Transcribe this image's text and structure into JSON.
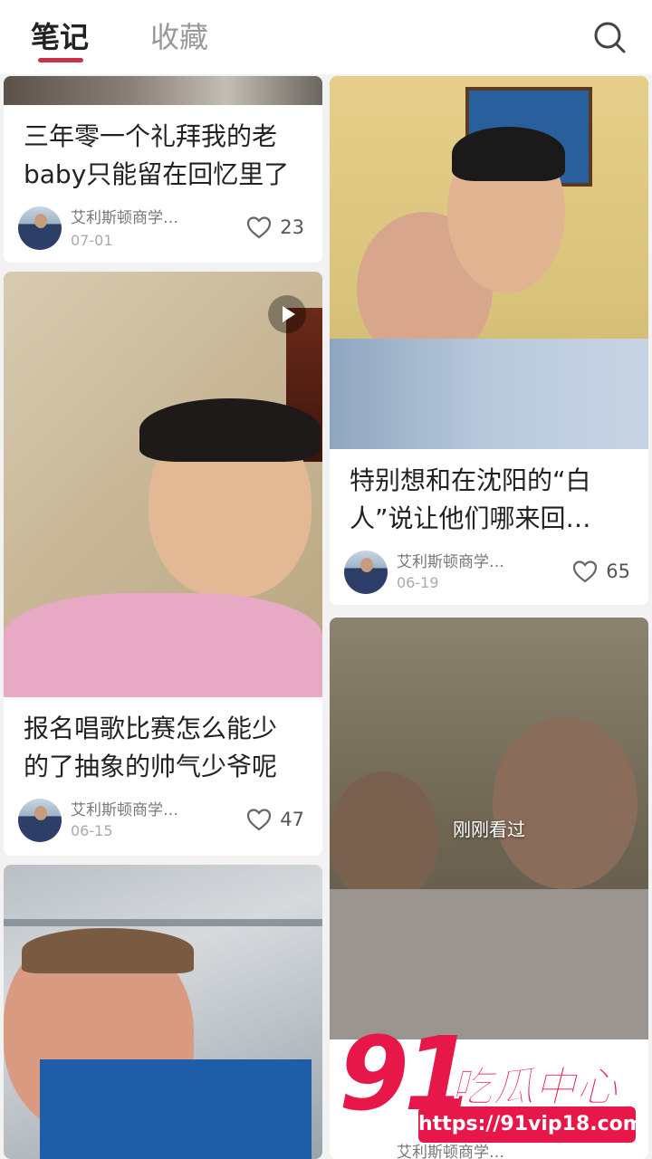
{
  "tabs": {
    "notes": "笔记",
    "favorites": "收藏"
  },
  "icons": {
    "search": "search-icon",
    "like": "heart-outline-icon",
    "play": "play-icon"
  },
  "colors": {
    "accent": "#c8324a",
    "watermark": "#e8174a"
  },
  "cards": {
    "c1": {
      "title_line1": "三年零一个礼拜我的老",
      "title_line2": "baby只能留在回忆里了",
      "author": "艾利斯顿商学…",
      "date": "07-01",
      "likes": "23"
    },
    "c2": {
      "title_line1": "报名唱歌比赛怎么能少",
      "title_line2": "的了抽象的帅气少爷呢",
      "author": "艾利斯顿商学…",
      "date": "06-15",
      "likes": "47"
    },
    "c3": {
      "title_line1": "特别想和在沈阳的“白",
      "title_line2": "人”说让他们哪来回…",
      "author": "艾利斯顿商学…",
      "date": "06-19",
      "likes": "65"
    },
    "c4": {
      "overlay": "刚刚看过",
      "author": "艾利斯顿商学…"
    }
  },
  "watermark": {
    "number": "91",
    "text": "吃瓜中心",
    "url": "https://91vip18.com"
  }
}
